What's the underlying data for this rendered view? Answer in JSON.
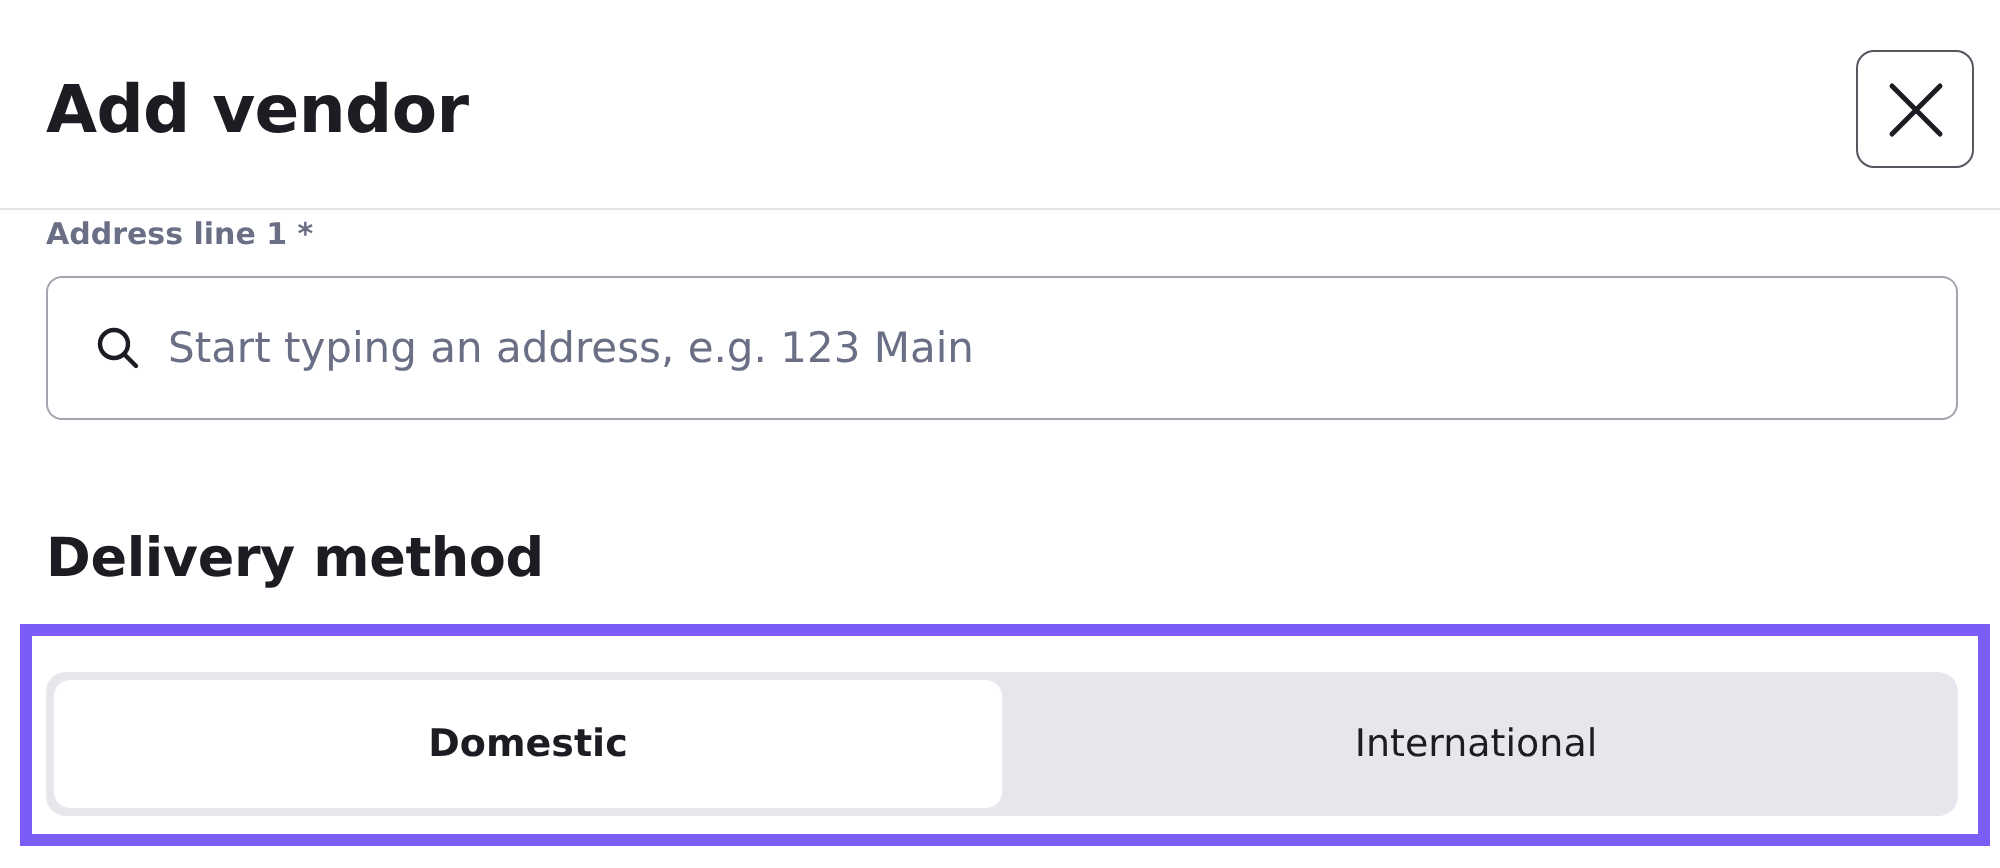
{
  "dialog": {
    "title": "Add vendor"
  },
  "address_field": {
    "label": "Address line 1 *",
    "placeholder": "Start typing an address, e.g. 123 Main"
  },
  "delivery": {
    "heading": "Delivery method",
    "highlighted": true,
    "options": [
      {
        "label": "Domestic",
        "selected": true
      },
      {
        "label": "International",
        "selected": false
      }
    ]
  }
}
